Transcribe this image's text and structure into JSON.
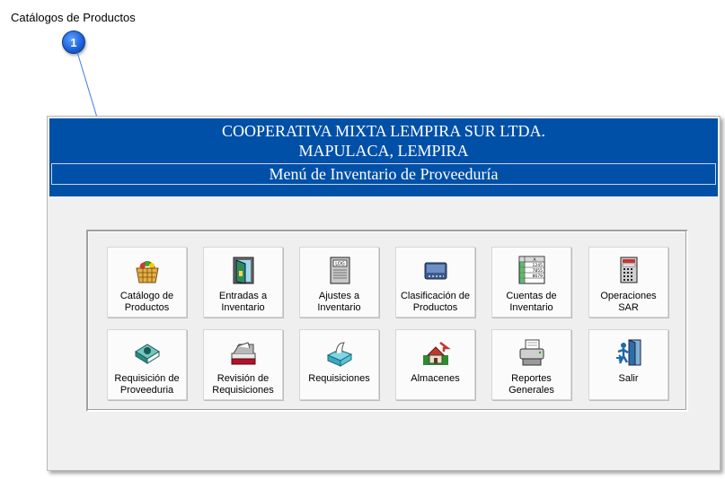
{
  "doc": {
    "title": "Catálogos de Productos",
    "callout_number": "1"
  },
  "header": {
    "org_name": "COOPERATIVA MIXTA LEMPIRA SUR LTDA.",
    "org_place": "MAPULACA, LEMPIRA",
    "menu_title": "Menú de Inventario de Proveeduría"
  },
  "colors": {
    "header_blue": "#0050a8",
    "callout_blue": "#1a5fd6"
  },
  "tiles": [
    {
      "label": "Catálogo de\nProductos",
      "icon": "basket-icon"
    },
    {
      "label": "Entradas a\nInventario",
      "icon": "door-entry-icon"
    },
    {
      "label": "Ajustes a\nInventario",
      "icon": "log-book-icon"
    },
    {
      "label": "Clasificación de\nProductos",
      "icon": "tray-icon"
    },
    {
      "label": "Cuentas de\nInventario",
      "icon": "spreadsheet-icon",
      "sheet_values": [
        "A",
        "1245",
        "7855",
        "8679"
      ]
    },
    {
      "label": "Operaciones\nSAR",
      "icon": "calculator-icon"
    },
    {
      "label": "Requisición de\nProveeduria",
      "icon": "book-icon"
    },
    {
      "label": "Revisión de\nRequisiciones",
      "icon": "stamp-icon"
    },
    {
      "label": "Requisiciones",
      "icon": "tissue-box-icon"
    },
    {
      "label": "Almacenes",
      "icon": "warehouse-icon"
    },
    {
      "label": "Reportes\nGenerales",
      "icon": "printer-icon"
    },
    {
      "label": "Salir",
      "icon": "exit-door-icon"
    }
  ]
}
